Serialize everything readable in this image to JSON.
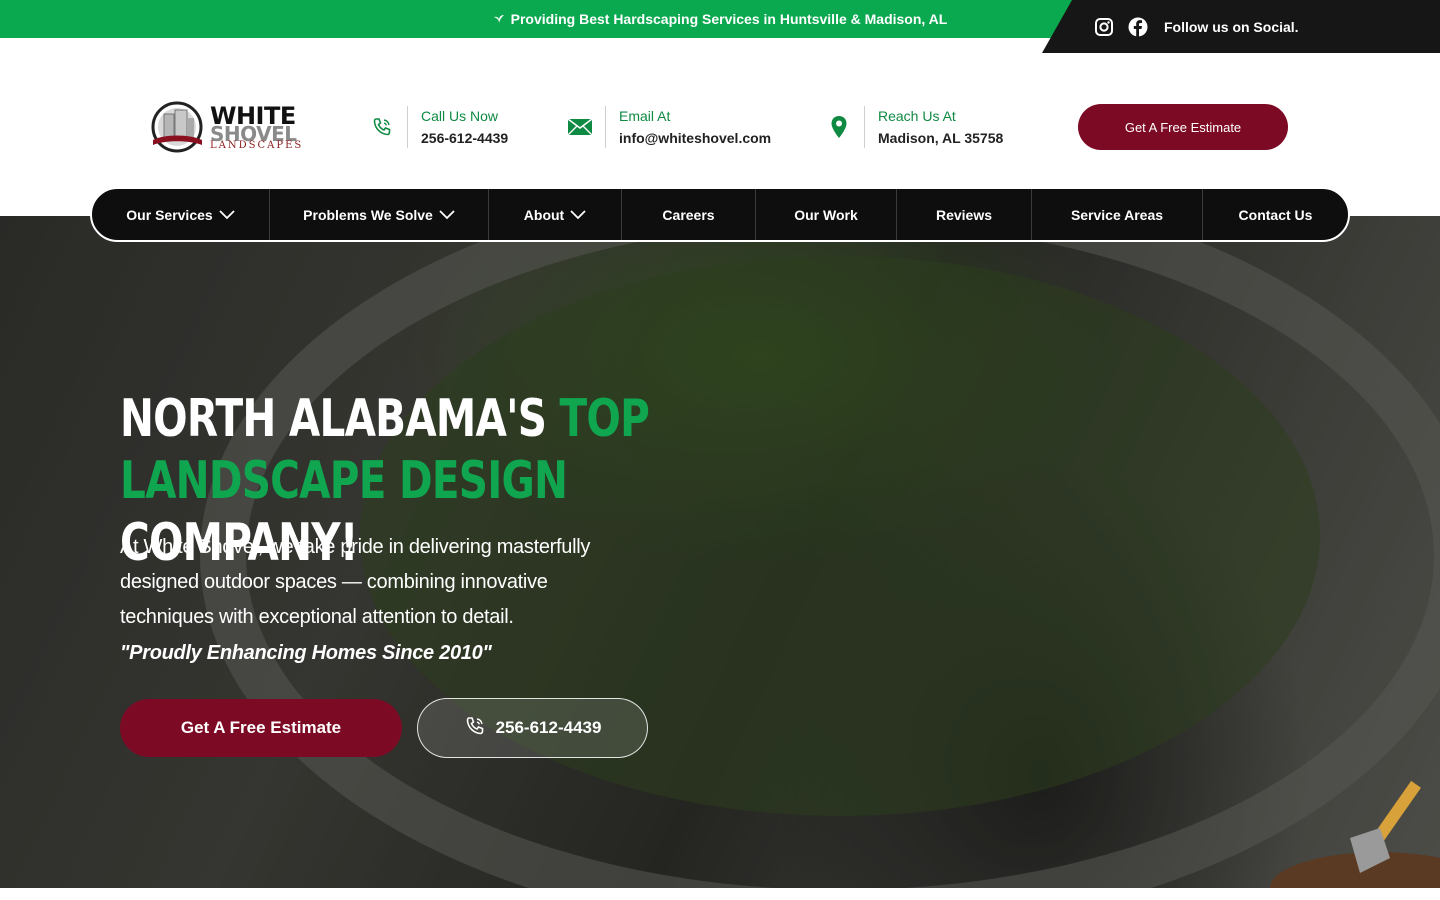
{
  "topbar": {
    "message": "Providing Best Hardscaping Services in Huntsville & Madison, AL",
    "leaf_icon": "leaf-icon",
    "social_label": "Follow us on Social.",
    "social_icons": [
      "instagram-icon",
      "facebook-icon"
    ]
  },
  "logo": {
    "word1": "WHITE",
    "word2": "SHOVEL",
    "word3": "LANDSCAPES"
  },
  "contacts": [
    {
      "icon": "phone-icon",
      "label": "Call Us Now",
      "value": "256-612-4439"
    },
    {
      "icon": "envelope-icon",
      "label": "Email At",
      "value": "info@whiteshovel.com"
    },
    {
      "icon": "map-pin-icon",
      "label": "Reach Us At",
      "value": "Madison, AL 35758"
    }
  ],
  "header_cta": "Get A Free Estimate",
  "nav": [
    {
      "label": "Our Services",
      "dropdown": true
    },
    {
      "label": "Problems We Solve",
      "dropdown": true
    },
    {
      "label": "About",
      "dropdown": true
    },
    {
      "label": "Careers",
      "dropdown": false
    },
    {
      "label": "Our Work",
      "dropdown": false
    },
    {
      "label": "Reviews",
      "dropdown": false
    },
    {
      "label": "Service Areas",
      "dropdown": false
    },
    {
      "label": "Contact Us",
      "dropdown": false
    }
  ],
  "hero": {
    "title_part1": "NORTH ALABAMA'S ",
    "title_part2": "TOP",
    "title_part3": "LANDSCAPE DESIGN",
    "title_part4": " COMPANY!",
    "paragraph": "At White Shovel, we take pride in delivering masterfully designed outdoor spaces — combining innovative techniques with exceptional attention to detail.",
    "quote": "\"Proudly Enhancing Homes Since 2010\"",
    "cta_estimate": "Get A Free Estimate",
    "cta_phone": "256-612-4439"
  },
  "colors": {
    "brand_green": "#0aa950",
    "brand_maroon": "#7d0a24",
    "nav_dark": "#0e0e0e"
  }
}
